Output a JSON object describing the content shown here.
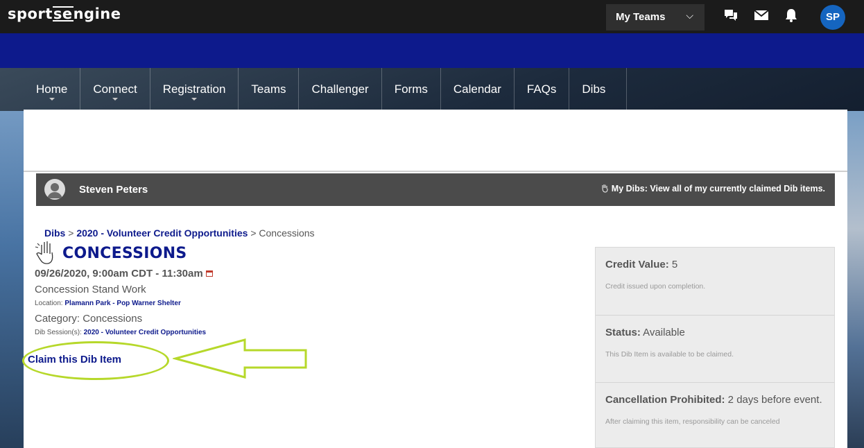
{
  "topbar": {
    "logo_left": "sport",
    "logo_mid": "se",
    "logo_right": "ngine",
    "my_teams_label": "My Teams",
    "chevron": "⌵",
    "avatar_initials": "SP",
    "icons": [
      "chat-icon",
      "mail-icon",
      "bell-icon"
    ]
  },
  "nav": {
    "items": [
      {
        "label": "Home",
        "dropdown": true
      },
      {
        "label": "Connect",
        "dropdown": true
      },
      {
        "label": "Registration",
        "dropdown": true
      },
      {
        "label": "Teams",
        "dropdown": false
      },
      {
        "label": "Challenger",
        "dropdown": false
      },
      {
        "label": "Forms",
        "dropdown": false
      },
      {
        "label": "Calendar",
        "dropdown": false
      },
      {
        "label": "FAQs",
        "dropdown": false
      },
      {
        "label": "Dibs",
        "dropdown": false
      }
    ]
  },
  "userbar": {
    "name": "Steven Peters",
    "my_dibs": "My Dibs: View all of my currently claimed Dib items."
  },
  "breadcrumb": {
    "root": "Dibs",
    "sep": " > ",
    "session": "2020 - Volunteer Credit Opportunities",
    "current": "Concessions"
  },
  "item": {
    "title": "CONCESSIONS",
    "datetime": "09/26/2020, 9:00am CDT - 11:30am",
    "description": "Concession Stand Work",
    "location_label": "Location: ",
    "location_value": "Plamann Park - Pop Warner Shelter",
    "category": "Category: Concessions",
    "session_label": "Dib Session(s): ",
    "session_value": "2020 - Volunteer Credit Opportunities",
    "claim_label": "Claim this Dib Item"
  },
  "panel": {
    "credit_label": "Credit Value:",
    "credit_value": " 5",
    "credit_note": "Credit issued upon completion.",
    "status_label": "Status:",
    "status_value": " Available",
    "status_note": "This Dib Item is available to be claimed.",
    "cancel_label": "Cancellation Prohibited:",
    "cancel_value": " 2 days before event.",
    "cancel_note": "After claiming this item, responsibility can be canceled"
  },
  "colors": {
    "brand_navy": "#0d1a8c",
    "topbar": "#1b1b1b",
    "avatar_blue": "#1565c0",
    "annotation_green": "#b6d82a"
  }
}
